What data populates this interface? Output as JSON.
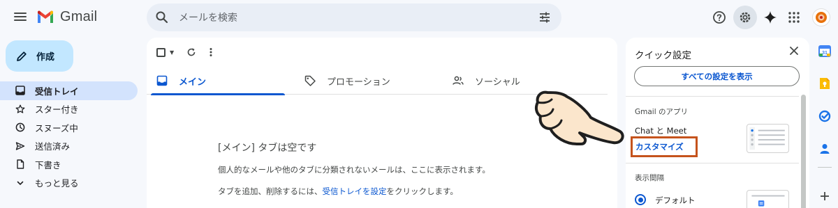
{
  "header": {
    "app_name": "Gmail",
    "search_placeholder": "メールを検索",
    "avatar_initial": ""
  },
  "compose": {
    "label": "作成"
  },
  "nav": {
    "items": [
      {
        "label": "受信トレイ",
        "icon": "inbox-icon",
        "active": true
      },
      {
        "label": "スター付き",
        "icon": "star-icon"
      },
      {
        "label": "スヌーズ中",
        "icon": "clock-icon"
      },
      {
        "label": "送信済み",
        "icon": "send-icon"
      },
      {
        "label": "下書き",
        "icon": "draft-icon"
      },
      {
        "label": "もっと見る",
        "icon": "chevron-down-icon"
      }
    ]
  },
  "tabs": [
    {
      "label": "メイン",
      "icon": "inbox-icon",
      "active": true
    },
    {
      "label": "プロモーション",
      "icon": "tag-icon"
    },
    {
      "label": "ソーシャル",
      "icon": "people-icon"
    }
  ],
  "empty_state": {
    "title": "[メイン] タブは空です",
    "line1": "個人的なメールや他のタブに分類されないメールは、ここに表示されます。",
    "line2_prefix": "タブを追加、削除するには、",
    "line2_link": "受信トレイを設定",
    "line2_suffix": "をクリックします。"
  },
  "quick_settings": {
    "title": "クイック設定",
    "all_settings_button": "すべての設定を表示",
    "apps_section": "Gmail のアプリ",
    "chat_meet": "Chat と Meet",
    "customize": "カスタマイズ",
    "density_section": "表示間隔",
    "density_default": "デフォルト"
  },
  "colors": {
    "accent": "#0b57d0",
    "compose_bg": "#c2e7ff",
    "highlight_box": "#c5531c"
  }
}
